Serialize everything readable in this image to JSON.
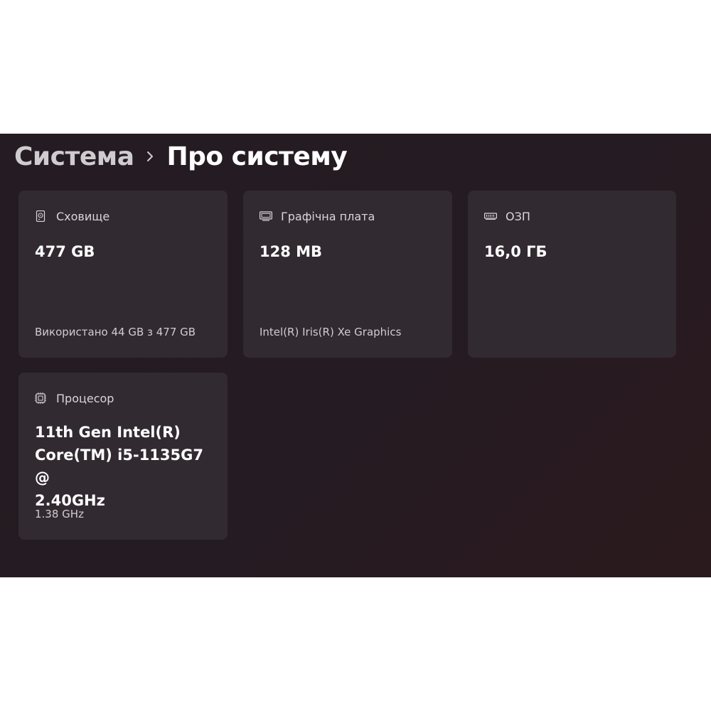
{
  "breadcrumb": {
    "parent": "Система",
    "current": "Про систему"
  },
  "cards": {
    "storage": {
      "icon": "hard-drive-icon",
      "label": "Сховище",
      "value": "477 GB",
      "detail": "Використано 44 GB з 477 GB"
    },
    "gpu": {
      "icon": "monitor-icon",
      "label": "Графічна плата",
      "value": "128 MB",
      "detail": "Intel(R) Iris(R) Xe Graphics"
    },
    "ram": {
      "icon": "memory-icon",
      "label": "ОЗП",
      "value": "16,0 ГБ"
    },
    "cpu": {
      "icon": "processor-icon",
      "label": "Процесор",
      "value_lines": [
        "11th Gen Intel(R)",
        "Core(TM) i5-1135G7 @",
        "2.40GHz"
      ],
      "detail": "1.38 GHz"
    }
  },
  "colors": {
    "panel_bg": "#241c22",
    "card_bg": "#322a31",
    "text_primary": "#ffffff",
    "text_secondary": "#d9d6d9"
  }
}
